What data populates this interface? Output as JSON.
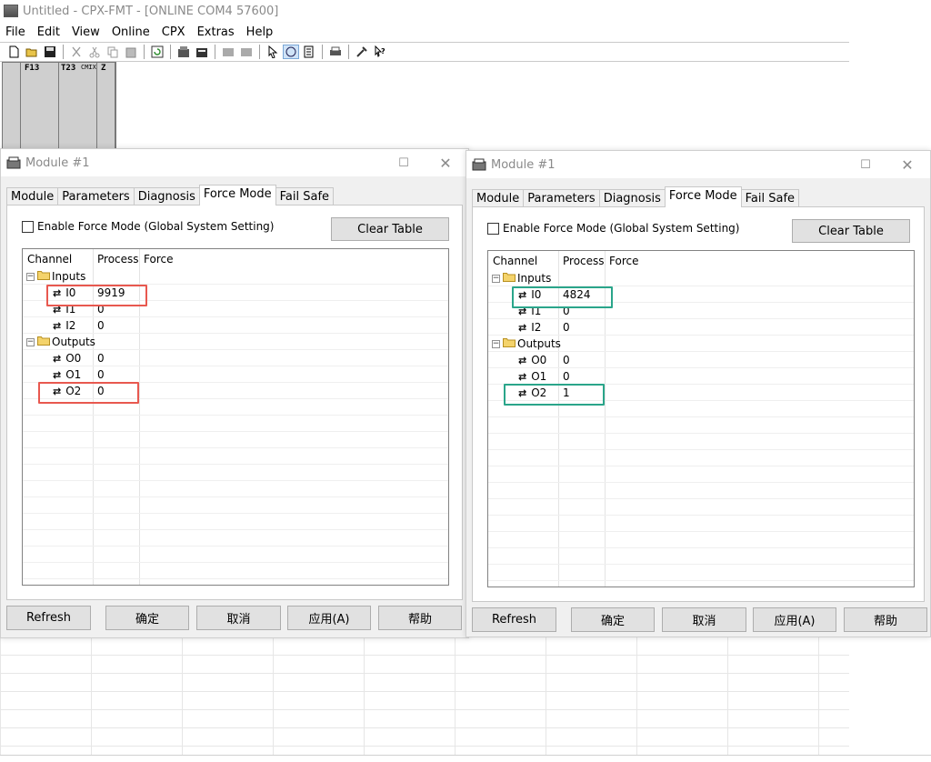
{
  "app": {
    "title": "Untitled - CPX-FMT - [ONLINE COM4 57600]",
    "menu": [
      "File",
      "Edit",
      "View",
      "Online",
      "CPX",
      "Extras",
      "Help"
    ],
    "rack_labels": [
      "F13",
      "T23",
      "CMIX",
      "Z"
    ]
  },
  "dialogs": [
    {
      "title": "Module #1",
      "tabs": [
        "Module",
        "Parameters",
        "Diagnosis",
        "Force Mode",
        "Fail Safe"
      ],
      "active_tab": "Force Mode",
      "enable_label": "Enable Force Mode (Global System Setting)",
      "clear_label": "Clear Table",
      "columns": [
        "Channel",
        "Process",
        "Force"
      ],
      "groups": [
        {
          "name": "Inputs",
          "channels": [
            {
              "name": "I0",
              "process": "9919"
            },
            {
              "name": "I1",
              "process": "0"
            },
            {
              "name": "I2",
              "process": "0"
            }
          ]
        },
        {
          "name": "Outputs",
          "channels": [
            {
              "name": "O0",
              "process": "0"
            },
            {
              "name": "O1",
              "process": "0"
            },
            {
              "name": "O2",
              "process": "0"
            }
          ]
        }
      ],
      "buttons": [
        "Refresh",
        "确定",
        "取消",
        "应用(A)",
        "帮助"
      ],
      "highlight_color": "#e8584f"
    },
    {
      "title": "Module #1",
      "tabs": [
        "Module",
        "Parameters",
        "Diagnosis",
        "Force Mode",
        "Fail Safe"
      ],
      "active_tab": "Force Mode",
      "enable_label": "Enable Force Mode (Global System Setting)",
      "clear_label": "Clear Table",
      "columns": [
        "Channel",
        "Process",
        "Force"
      ],
      "groups": [
        {
          "name": "Inputs",
          "channels": [
            {
              "name": "I0",
              "process": "4824"
            },
            {
              "name": "I1",
              "process": "0"
            },
            {
              "name": "I2",
              "process": "0"
            }
          ]
        },
        {
          "name": "Outputs",
          "channels": [
            {
              "name": "O0",
              "process": "0"
            },
            {
              "name": "O1",
              "process": "0"
            },
            {
              "name": "O2",
              "process": "1"
            }
          ]
        }
      ],
      "buttons": [
        "Refresh",
        "确定",
        "取消",
        "应用(A)",
        "帮助"
      ],
      "highlight_color": "#2aa58a"
    }
  ]
}
